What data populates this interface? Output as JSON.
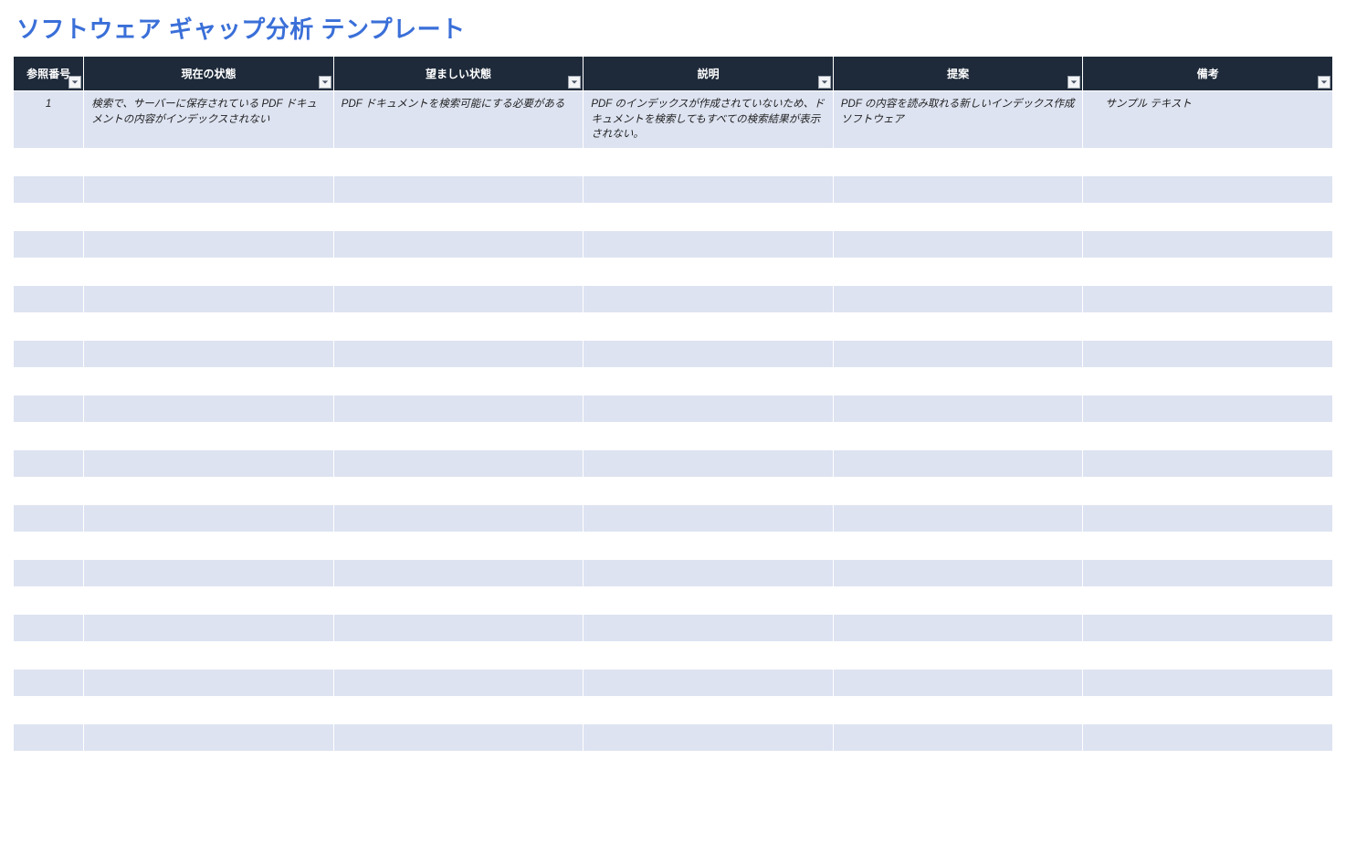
{
  "title": "ソフトウェア ギャップ分析 テンプレート",
  "columns": [
    {
      "key": "ref",
      "label": "参照番号"
    },
    {
      "key": "current",
      "label": "現在の状態"
    },
    {
      "key": "desired",
      "label": "望ましい状態"
    },
    {
      "key": "desc",
      "label": "説明"
    },
    {
      "key": "proposal",
      "label": "提案"
    },
    {
      "key": "notes",
      "label": "備考"
    }
  ],
  "rows": [
    {
      "ref": "1",
      "current": "検索で、サーバーに保存されている PDF ドキュメントの内容がインデックスされない",
      "desired": "PDF ドキュメントを検索可能にする必要がある",
      "desc": "PDF のインデックスが作成されていないため、ドキュメントを検索してもすべての検索結果が表示されない。",
      "proposal": "PDF の内容を読み取れる新しいインデックス作成ソフトウェア",
      "notes": "サンプル テキスト"
    }
  ],
  "empty_row_count": 22
}
